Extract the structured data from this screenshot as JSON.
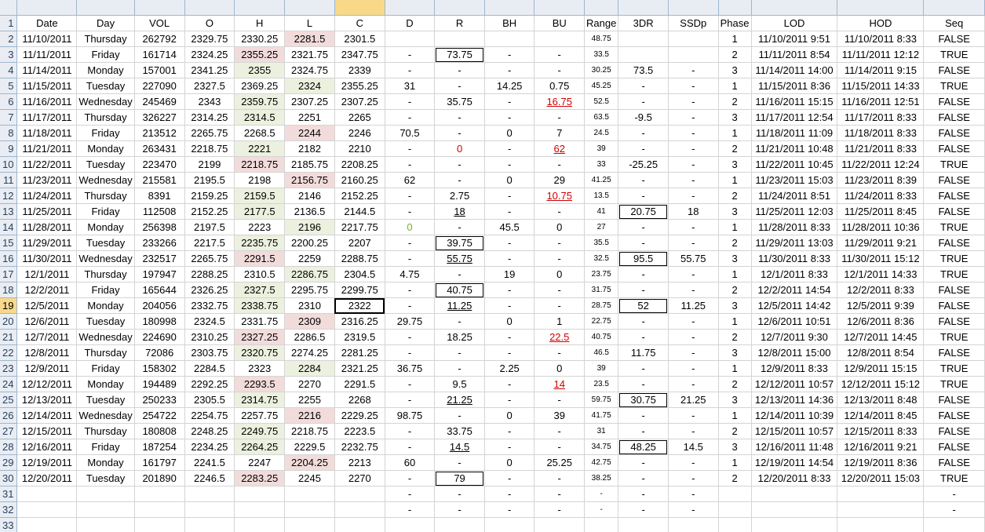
{
  "sheet": {
    "columns": [
      "A",
      "B",
      "C",
      "D",
      "E",
      "F",
      "G",
      "H",
      "I",
      "J",
      "K",
      "L",
      "M",
      "N",
      "O",
      "P",
      "Q",
      "R"
    ],
    "selected_column": "G",
    "selected_row": 19,
    "header_row": [
      "Date",
      "Day",
      "VOL",
      "O",
      "H",
      "L",
      "C",
      "D",
      "R",
      "BH",
      "BU",
      "Range",
      "3DR",
      "SSDp",
      "Phase",
      "LOD",
      "HOD",
      "Seq"
    ],
    "rows": [
      [
        "11/10/2011",
        "Thursday",
        "262792",
        "2329.75",
        "2330.25",
        "2281.5",
        "2301.5",
        "",
        "",
        "",
        "",
        "48.75",
        "",
        "",
        "1",
        "11/10/2011 9:51",
        "11/10/2011 8:33",
        "FALSE"
      ],
      [
        "11/11/2011",
        "Friday",
        "161714",
        "2324.25",
        "2355.25",
        "2321.75",
        "2347.75",
        "-",
        "73.75",
        "-",
        "-",
        "33.5",
        "",
        "",
        "2",
        "11/11/2011 8:54",
        "11/11/2011 12:12",
        "TRUE"
      ],
      [
        "11/14/2011",
        "Monday",
        "157001",
        "2341.25",
        "2355",
        "2324.75",
        "2339",
        "-",
        "-",
        "-",
        "-",
        "30.25",
        "73.5",
        "-",
        "3",
        "11/14/2011 14:00",
        "11/14/2011 9:15",
        "FALSE"
      ],
      [
        "11/15/2011",
        "Tuesday",
        "227090",
        "2327.5",
        "2369.25",
        "2324",
        "2355.25",
        "31",
        "-",
        "14.25",
        "0.75",
        "45.25",
        "-",
        "-",
        "1",
        "11/15/2011 8:36",
        "11/15/2011 14:33",
        "TRUE"
      ],
      [
        "11/16/2011",
        "Wednesday",
        "245469",
        "2343",
        "2359.75",
        "2307.25",
        "2307.25",
        "-",
        "35.75",
        "-",
        "16.75",
        "52.5",
        "-",
        "-",
        "2",
        "11/16/2011 15:15",
        "11/16/2011 12:51",
        "FALSE"
      ],
      [
        "11/17/2011",
        "Thursday",
        "326227",
        "2314.25",
        "2314.5",
        "2251",
        "2265",
        "-",
        "-",
        "-",
        "-",
        "63.5",
        "-9.5",
        "-",
        "3",
        "11/17/2011 12:54",
        "11/17/2011 8:33",
        "FALSE"
      ],
      [
        "11/18/2011",
        "Friday",
        "213512",
        "2265.75",
        "2268.5",
        "2244",
        "2246",
        "70.5",
        "-",
        "0",
        "7",
        "24.5",
        "-",
        "-",
        "1",
        "11/18/2011 11:09",
        "11/18/2011 8:33",
        "FALSE"
      ],
      [
        "11/21/2011",
        "Monday",
        "263431",
        "2218.75",
        "2221",
        "2182",
        "2210",
        "-",
        "0",
        "-",
        "62",
        "39",
        "-",
        "-",
        "2",
        "11/21/2011 10:48",
        "11/21/2011 8:33",
        "FALSE"
      ],
      [
        "11/22/2011",
        "Tuesday",
        "223470",
        "2199",
        "2218.75",
        "2185.75",
        "2208.25",
        "-",
        "-",
        "-",
        "-",
        "33",
        "-25.25",
        "-",
        "3",
        "11/22/2011 10:45",
        "11/22/2011 12:24",
        "TRUE"
      ],
      [
        "11/23/2011",
        "Wednesday",
        "215581",
        "2195.5",
        "2198",
        "2156.75",
        "2160.25",
        "62",
        "-",
        "0",
        "29",
        "41.25",
        "-",
        "-",
        "1",
        "11/23/2011 15:03",
        "11/23/2011 8:39",
        "FALSE"
      ],
      [
        "11/24/2011",
        "Thursday",
        "8391",
        "2159.25",
        "2159.5",
        "2146",
        "2152.25",
        "-",
        "2.75",
        "-",
        "10.75",
        "13.5",
        "-",
        "-",
        "2",
        "11/24/2011 8:51",
        "11/24/2011 8:33",
        "FALSE"
      ],
      [
        "11/25/2011",
        "Friday",
        "112508",
        "2152.25",
        "2177.5",
        "2136.5",
        "2144.5",
        "-",
        "18",
        "-",
        "-",
        "41",
        "20.75",
        "18",
        "3",
        "11/25/2011 12:03",
        "11/25/2011 8:45",
        "FALSE"
      ],
      [
        "11/28/2011",
        "Monday",
        "256398",
        "2197.5",
        "2223",
        "2196",
        "2217.75",
        "0",
        "-",
        "45.5",
        "0",
        "27",
        "-",
        "-",
        "1",
        "11/28/2011 8:33",
        "11/28/2011 10:36",
        "TRUE"
      ],
      [
        "11/29/2011",
        "Tuesday",
        "233266",
        "2217.5",
        "2235.75",
        "2200.25",
        "2207",
        "-",
        "39.75",
        "-",
        "-",
        "35.5",
        "-",
        "-",
        "2",
        "11/29/2011 13:03",
        "11/29/2011 9:21",
        "FALSE"
      ],
      [
        "11/30/2011",
        "Wednesday",
        "232517",
        "2265.75",
        "2291.5",
        "2259",
        "2288.75",
        "-",
        "55.75",
        "-",
        "-",
        "32.5",
        "95.5",
        "55.75",
        "3",
        "11/30/2011 8:33",
        "11/30/2011 15:12",
        "TRUE"
      ],
      [
        "12/1/2011",
        "Thursday",
        "197947",
        "2288.25",
        "2310.5",
        "2286.75",
        "2304.5",
        "4.75",
        "-",
        "19",
        "0",
        "23.75",
        "-",
        "-",
        "1",
        "12/1/2011 8:33",
        "12/1/2011 14:33",
        "TRUE"
      ],
      [
        "12/2/2011",
        "Friday",
        "165644",
        "2326.25",
        "2327.5",
        "2295.75",
        "2299.75",
        "-",
        "40.75",
        "-",
        "-",
        "31.75",
        "-",
        "-",
        "2",
        "12/2/2011 14:54",
        "12/2/2011 8:33",
        "FALSE"
      ],
      [
        "12/5/2011",
        "Monday",
        "204056",
        "2332.75",
        "2338.75",
        "2310",
        "2322",
        "-",
        "11.25",
        "-",
        "-",
        "28.75",
        "52",
        "11.25",
        "3",
        "12/5/2011 14:42",
        "12/5/2011 9:39",
        "FALSE"
      ],
      [
        "12/6/2011",
        "Tuesday",
        "180998",
        "2324.5",
        "2331.75",
        "2309",
        "2316.25",
        "29.75",
        "-",
        "0",
        "1",
        "22.75",
        "-",
        "-",
        "1",
        "12/6/2011 10:51",
        "12/6/2011 8:36",
        "FALSE"
      ],
      [
        "12/7/2011",
        "Wednesday",
        "224690",
        "2310.25",
        "2327.25",
        "2286.5",
        "2319.5",
        "-",
        "18.25",
        "-",
        "22.5",
        "40.75",
        "-",
        "-",
        "2",
        "12/7/2011 9:30",
        "12/7/2011 14:45",
        "TRUE"
      ],
      [
        "12/8/2011",
        "Thursday",
        "72086",
        "2303.75",
        "2320.75",
        "2274.25",
        "2281.25",
        "-",
        "-",
        "-",
        "-",
        "46.5",
        "11.75",
        "-",
        "3",
        "12/8/2011 15:00",
        "12/8/2011 8:54",
        "FALSE"
      ],
      [
        "12/9/2011",
        "Friday",
        "158302",
        "2284.5",
        "2323",
        "2284",
        "2321.25",
        "36.75",
        "-",
        "2.25",
        "0",
        "39",
        "-",
        "-",
        "1",
        "12/9/2011 8:33",
        "12/9/2011 15:15",
        "TRUE"
      ],
      [
        "12/12/2011",
        "Monday",
        "194489",
        "2292.25",
        "2293.5",
        "2270",
        "2291.5",
        "-",
        "9.5",
        "-",
        "14",
        "23.5",
        "-",
        "-",
        "2",
        "12/12/2011 10:57",
        "12/12/2011 15:12",
        "TRUE"
      ],
      [
        "12/13/2011",
        "Tuesday",
        "250233",
        "2305.5",
        "2314.75",
        "2255",
        "2268",
        "-",
        "21.25",
        "-",
        "-",
        "59.75",
        "30.75",
        "21.25",
        "3",
        "12/13/2011 14:36",
        "12/13/2011 8:48",
        "FALSE"
      ],
      [
        "12/14/2011",
        "Wednesday",
        "254722",
        "2254.75",
        "2257.75",
        "2216",
        "2229.25",
        "98.75",
        "-",
        "0",
        "39",
        "41.75",
        "-",
        "-",
        "1",
        "12/14/2011 10:39",
        "12/14/2011 8:45",
        "FALSE"
      ],
      [
        "12/15/2011",
        "Thursday",
        "180808",
        "2248.25",
        "2249.75",
        "2218.75",
        "2223.5",
        "-",
        "33.75",
        "-",
        "-",
        "31",
        "-",
        "-",
        "2",
        "12/15/2011 10:57",
        "12/15/2011 8:33",
        "FALSE"
      ],
      [
        "12/16/2011",
        "Friday",
        "187254",
        "2234.25",
        "2264.25",
        "2229.5",
        "2232.75",
        "-",
        "14.5",
        "-",
        "-",
        "34.75",
        "48.25",
        "14.5",
        "3",
        "12/16/2011 11:48",
        "12/16/2011 9:21",
        "FALSE"
      ],
      [
        "12/19/2011",
        "Monday",
        "161797",
        "2241.5",
        "2247",
        "2204.25",
        "2213",
        "60",
        "-",
        "0",
        "25.25",
        "42.75",
        "-",
        "-",
        "1",
        "12/19/2011 14:54",
        "12/19/2011 8:36",
        "FALSE"
      ],
      [
        "12/20/2011",
        "Tuesday",
        "201890",
        "2246.5",
        "2283.25",
        "2245",
        "2270",
        "-",
        "79",
        "-",
        "-",
        "38.25",
        "-",
        "-",
        "2",
        "12/20/2011 8:33",
        "12/20/2011 15:03",
        "TRUE"
      ],
      [
        "",
        "",
        "",
        "",
        "",
        "",
        "",
        "-",
        "-",
        "-",
        "-",
        "-",
        "-",
        "-",
        "",
        "",
        "",
        "-"
      ],
      [
        "",
        "",
        "",
        "",
        "",
        "",
        "",
        "-",
        "-",
        "-",
        "-",
        "-",
        "-",
        "-",
        "",
        "",
        "",
        "-"
      ],
      [
        "",
        "",
        "",
        "",
        "",
        "",
        "",
        "",
        "",
        "",
        "",
        "",
        "",
        "",
        "",
        "",
        "",
        ""
      ]
    ],
    "colors": {
      "header_bg": "#e9edf3",
      "selected_header_bg": "#f8d98a",
      "green_fill": "#ebf1de",
      "pink_fill": "#f2dcdb",
      "red_text": "#d00000",
      "green_text": "#7ab02f"
    }
  }
}
